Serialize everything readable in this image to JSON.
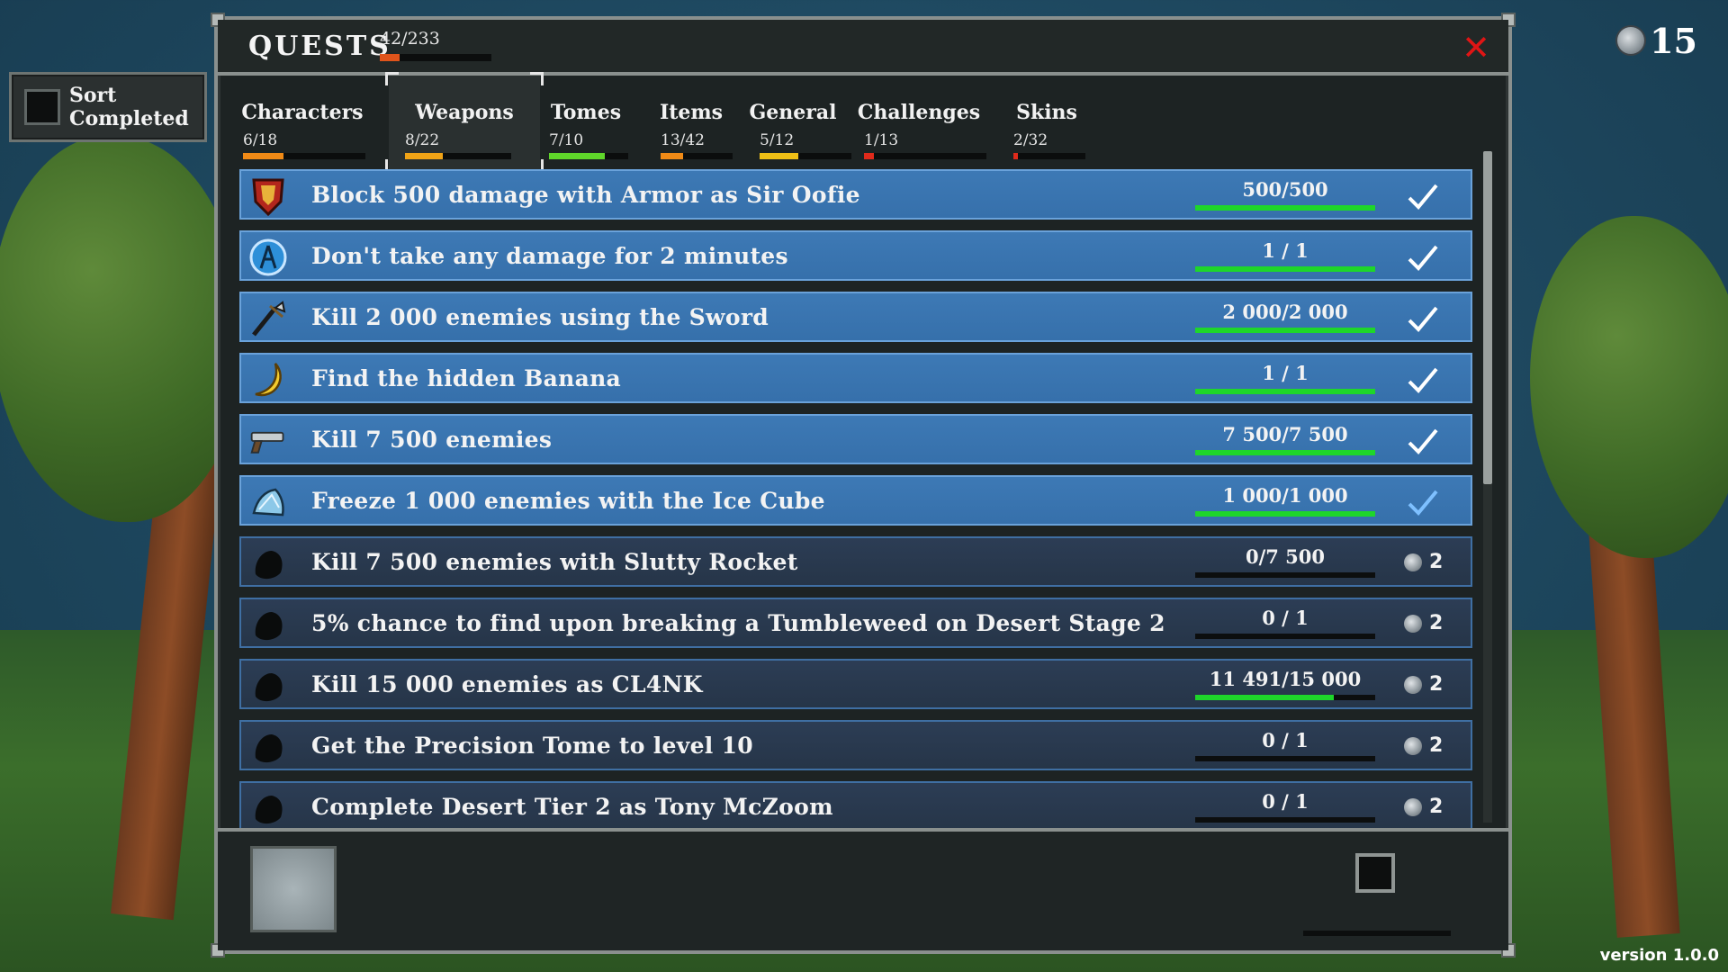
{
  "sort": {
    "label": "Sort Completed"
  },
  "coins": {
    "count": "15"
  },
  "version": "version 1.0.0",
  "header": {
    "title": "QUESTS",
    "count": "42/233",
    "progress": 0.18,
    "close_symbol": "✕"
  },
  "tabs": [
    {
      "label": "Characters",
      "count": "6/18",
      "progress": 0.33,
      "color": "#f08a16"
    },
    {
      "label": "Weapons",
      "count": "8/22",
      "progress": 0.36,
      "color": "#f0a316",
      "active": true
    },
    {
      "label": "Tomes",
      "count": "7/10",
      "progress": 0.7,
      "color": "#5fd62a"
    },
    {
      "label": "Items",
      "count": "13/42",
      "progress": 0.31,
      "color": "#f08a16"
    },
    {
      "label": "General",
      "count": "5/12",
      "progress": 0.42,
      "color": "#f0c016"
    },
    {
      "label": "Challenges",
      "count": "1/13",
      "progress": 0.08,
      "color": "#e02a1b"
    },
    {
      "label": "Skins",
      "count": "2/32",
      "progress": 0.06,
      "color": "#e02a1b"
    }
  ],
  "quests": [
    {
      "text": "Block 500 damage with Armor as Sir Oofie",
      "progress": "500/500",
      "fraction": 1.0,
      "done": true,
      "icon": "armor-icon"
    },
    {
      "text": "Don't take any damage for 2 minutes",
      "progress": "1 / 1",
      "fraction": 1.0,
      "done": true,
      "icon": "shield-figure-icon"
    },
    {
      "text": "Kill 2 000 enemies using the Sword",
      "progress": "2 000/2 000",
      "fraction": 1.0,
      "done": true,
      "icon": "sword-icon"
    },
    {
      "text": "Find the hidden Banana",
      "progress": "1 / 1",
      "fraction": 1.0,
      "done": true,
      "icon": "banana-icon"
    },
    {
      "text": "Kill 7 500 enemies",
      "progress": "7 500/7 500",
      "fraction": 1.0,
      "done": true,
      "icon": "revolver-icon"
    },
    {
      "text": "Freeze 1 000 enemies with the Ice Cube",
      "progress": "1 000/1 000",
      "fraction": 1.0,
      "done": true,
      "icon": "ice-cube-icon"
    },
    {
      "text": "Kill 7 500 enemies with Slutty Rocket",
      "progress": "0/7 500",
      "fraction": 0,
      "done": false,
      "reward": "2",
      "icon": "locked-silhouette-icon"
    },
    {
      "text": "5% chance to find upon breaking a Tumbleweed on Desert Stage 2",
      "progress": "0 / 1",
      "fraction": 0,
      "done": false,
      "reward": "2",
      "icon": "locked-silhouette-icon"
    },
    {
      "text": "Kill 15 000 enemies as CL4NK",
      "progress": "11 491/15 000",
      "fraction": 0.77,
      "done": false,
      "reward": "2",
      "icon": "locked-silhouette-icon"
    },
    {
      "text": "Get the Precision Tome to level 10",
      "progress": "0 / 1",
      "fraction": 0,
      "done": false,
      "reward": "2",
      "icon": "locked-silhouette-icon"
    },
    {
      "text": "Complete Desert Tier 2 as Tony McZoom",
      "progress": "0 / 1",
      "fraction": 0,
      "done": false,
      "reward": "2",
      "icon": "locked-silhouette-icon"
    }
  ]
}
